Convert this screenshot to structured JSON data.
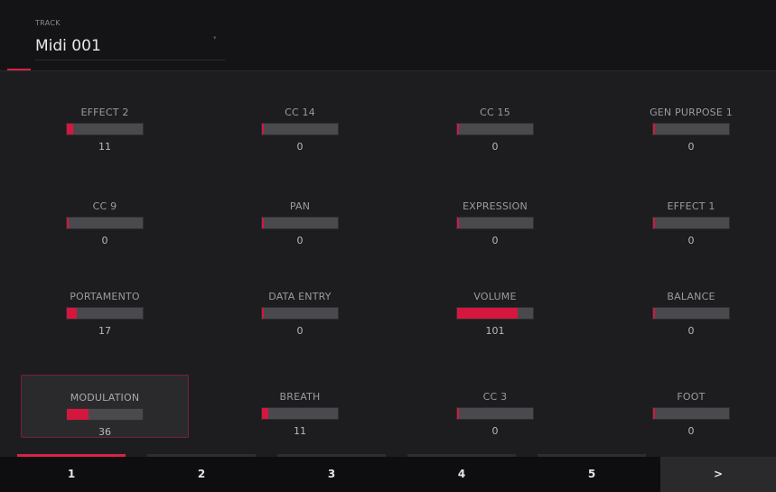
{
  "header": {
    "track_label": "TRACK",
    "track_name": "Midi 001",
    "chevron": "▾"
  },
  "controls": [
    {
      "label": "EFFECT 2",
      "value": "11",
      "level": 0.087
    },
    {
      "label": "CC 14",
      "value": "0",
      "level": 0
    },
    {
      "label": "CC 15",
      "value": "0",
      "level": 0
    },
    {
      "label": "GEN PURPOSE 1",
      "value": "0",
      "level": 0
    },
    {
      "label": "CC 9",
      "value": "0",
      "level": 0
    },
    {
      "label": "PAN",
      "value": "0",
      "level": 0
    },
    {
      "label": "EXPRESSION",
      "value": "0",
      "level": 0
    },
    {
      "label": "EFFECT 1",
      "value": "0",
      "level": 0
    },
    {
      "label": "PORTAMENTO",
      "value": "17",
      "level": 0.134
    },
    {
      "label": "DATA ENTRY",
      "value": "0",
      "level": 0
    },
    {
      "label": "VOLUME",
      "value": "101",
      "level": 0.795
    },
    {
      "label": "BALANCE",
      "value": "0",
      "level": 0
    },
    {
      "label": "MODULATION",
      "value": "36",
      "level": 0.283,
      "selected": true
    },
    {
      "label": "BREATH",
      "value": "11",
      "level": 0.087
    },
    {
      "label": "CC 3",
      "value": "0",
      "level": 0
    },
    {
      "label": "FOOT",
      "value": "0",
      "level": 0
    }
  ],
  "footer": {
    "tabs": [
      "1",
      "2",
      "3",
      "4",
      "5"
    ],
    "active_tab": "1",
    "next_label": ">"
  },
  "colors": {
    "accent": "#d5173f",
    "background": "#1d1d1f",
    "bar_track": "#4a4a4e"
  }
}
